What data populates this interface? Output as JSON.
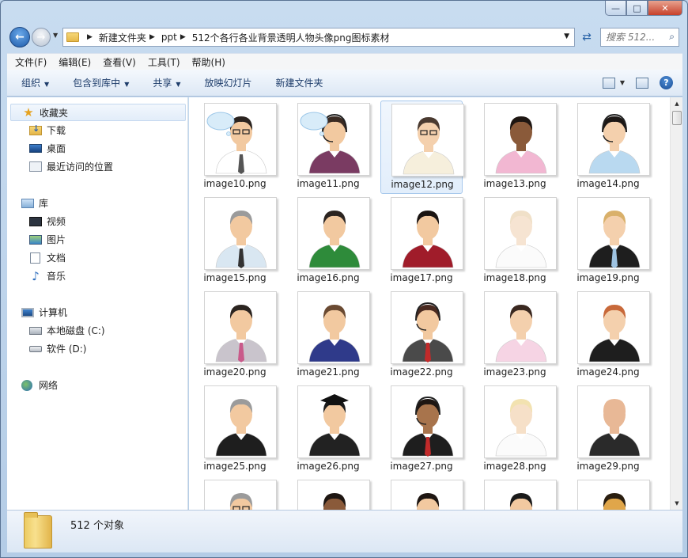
{
  "window": {
    "minimize_glyph": "—",
    "maximize_glyph": "□",
    "close_glyph": "✕"
  },
  "address": {
    "crumbs": [
      "新建文件夹",
      "ppt",
      "512个各行各业背景透明人物头像png图标素材"
    ]
  },
  "search": {
    "placeholder": "搜索 512..."
  },
  "menu": {
    "file": "文件(F)",
    "edit": "编辑(E)",
    "view": "查看(V)",
    "tools": "工具(T)",
    "help": "帮助(H)"
  },
  "toolbar": {
    "organize": "组织",
    "include_library": "包含到库中",
    "share": "共享",
    "slideshow": "放映幻灯片",
    "new_folder": "新建文件夹"
  },
  "sidebar": {
    "favorites": "收藏夹",
    "downloads": "下载",
    "desktop": "桌面",
    "recent": "最近访问的位置",
    "libraries": "库",
    "videos": "视频",
    "pictures": "图片",
    "documents": "文档",
    "music": "音乐",
    "computer": "计算机",
    "local_disk_c": "本地磁盘 (C:)",
    "software_d": "软件 (D:)",
    "network": "网络"
  },
  "files": [
    {
      "name": "image10.png",
      "skin": "#f2c9a0",
      "hair": "#2b2420",
      "shirt": "#ffffff",
      "tie": "#555555",
      "bubble": true,
      "glasses": true
    },
    {
      "name": "image11.png",
      "skin": "#f2c9a0",
      "hair": "#3a2a22",
      "shirt": "#7a3b62",
      "tie": "",
      "bubble": true,
      "headset": true
    },
    {
      "name": "image12.png",
      "skin": "#f4d0ad",
      "hair": "#4a3a30",
      "shirt": "#f6efdc",
      "tie": "",
      "glasses": true
    },
    {
      "name": "image13.png",
      "skin": "#8a5a3a",
      "hair": "#1e1612",
      "shirt": "#f2b7d2",
      "tie": ""
    },
    {
      "name": "image14.png",
      "skin": "#f4d0ad",
      "hair": "#1c1715",
      "shirt": "#b9d9f0",
      "tie": "",
      "headset": true
    },
    {
      "name": "image15.png",
      "skin": "#f2c9a0",
      "hair": "#9b9b9b",
      "shirt": "#d9e7f2",
      "tie": "#333333"
    },
    {
      "name": "image16.png",
      "skin": "#f2c9a0",
      "hair": "#2b2420",
      "shirt": "#2e8b3a",
      "tie": ""
    },
    {
      "name": "image17.png",
      "skin": "#f2c9a0",
      "hair": "#1a1412",
      "shirt": "#a01c2a",
      "tie": ""
    },
    {
      "name": "image18.png",
      "skin": "#f6e4d2",
      "hair": "#f0e0c8",
      "shirt": "#fbfbfb",
      "tie": ""
    },
    {
      "name": "image19.png",
      "skin": "#f4d0ad",
      "hair": "#d9b06a",
      "shirt": "#1e1e1e",
      "tie": "#9ec3e2"
    },
    {
      "name": "image20.png",
      "skin": "#f2c9a0",
      "hair": "#2b2420",
      "shirt": "#c9c4cc",
      "tie": "#c95a8a"
    },
    {
      "name": "image21.png",
      "skin": "#f2c9a0",
      "hair": "#6a4a32",
      "shirt": "#2f3a8a",
      "tie": ""
    },
    {
      "name": "image22.png",
      "skin": "#f2c9a0",
      "hair": "#4a2a20",
      "shirt": "#4a4a4a",
      "tie": "#c22a2a",
      "headset": true
    },
    {
      "name": "image23.png",
      "skin": "#f4d0ad",
      "hair": "#3a2820",
      "shirt": "#f6d4e4",
      "tie": ""
    },
    {
      "name": "image24.png",
      "skin": "#f4d0ad",
      "hair": "#c8693a",
      "shirt": "#1e1e1e",
      "tie": ""
    },
    {
      "name": "image25.png",
      "skin": "#f2c9a0",
      "hair": "#9b9b9b",
      "shirt": "#1e1e1e",
      "tie": ""
    },
    {
      "name": "image26.png",
      "skin": "#f2c9a0",
      "hair": "#1a1a1a",
      "shirt": "#222222",
      "tie": "",
      "cap": true
    },
    {
      "name": "image27.png",
      "skin": "#a8744c",
      "hair": "#1e1612",
      "shirt": "#1e1e1e",
      "tie": "#c22a2a",
      "headset": true
    },
    {
      "name": "image28.png",
      "skin": "#f6e0c8",
      "hair": "#f2e2b0",
      "shirt": "#fbfbfb",
      "tie": ""
    },
    {
      "name": "image29.png",
      "skin": "#e8b896",
      "hair": "#e8b896",
      "shirt": "#2a2a2a",
      "tie": ""
    },
    {
      "name": "",
      "skin": "#f2c9a0",
      "hair": "#9b9b9b",
      "shirt": "#ffffff",
      "tie": "",
      "glasses": true
    },
    {
      "name": "",
      "skin": "#8a5a3a",
      "hair": "#1e1612",
      "shirt": "#ffffff",
      "tie": ""
    },
    {
      "name": "",
      "skin": "#f2c9a0",
      "hair": "#1e1612",
      "shirt": "#ffffff",
      "tie": ""
    },
    {
      "name": "",
      "skin": "#f2c9a0",
      "hair": "#1a1a1a",
      "shirt": "#ffffff",
      "tie": ""
    },
    {
      "name": "",
      "skin": "#e0a64a",
      "hair": "#2a1e10",
      "shirt": "#ffffff",
      "tie": ""
    }
  ],
  "selected_file": "image12.png",
  "status": {
    "count": "512 个对象"
  },
  "colors": {
    "accent": "#1d5aa8",
    "selection": "#e2eefb",
    "selection_border": "#a7c8ec"
  }
}
